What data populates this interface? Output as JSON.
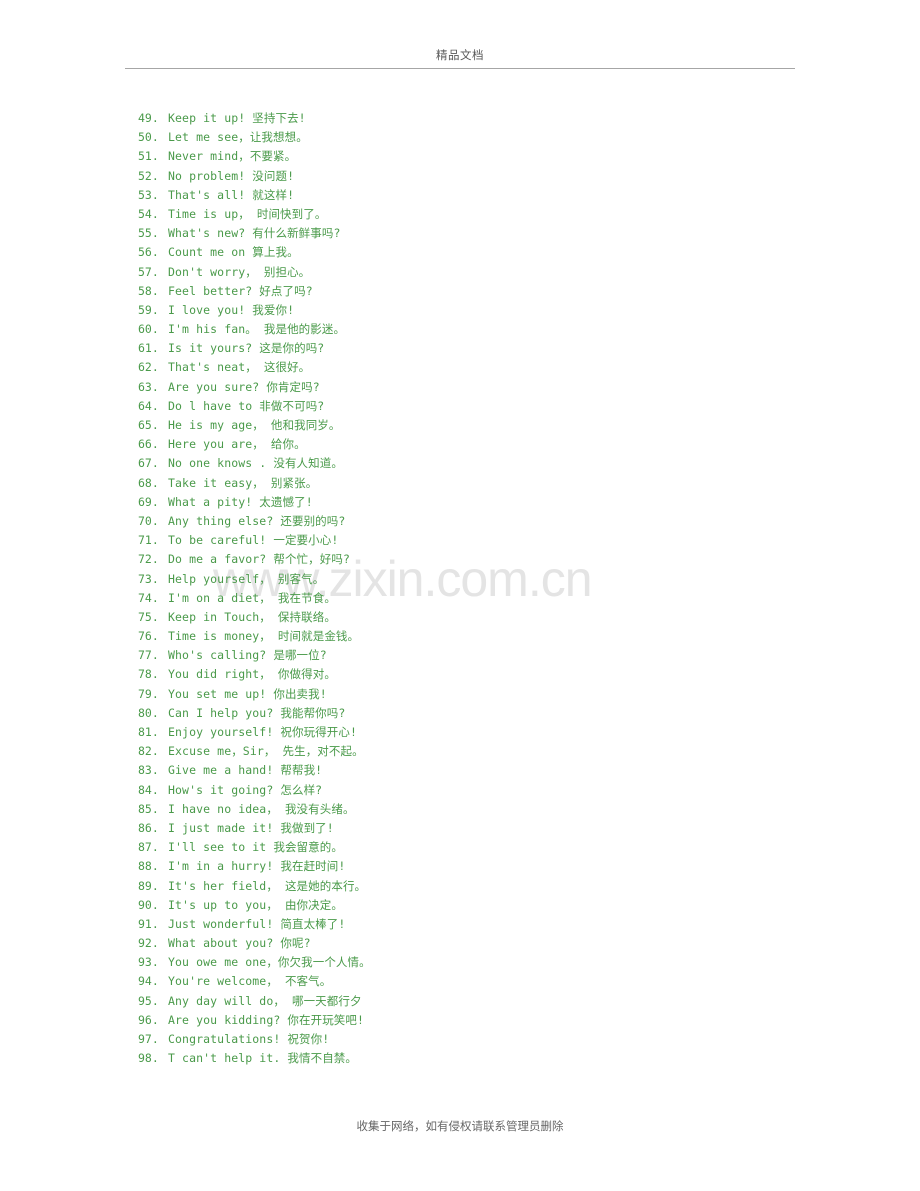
{
  "header": {
    "title": "精品文档"
  },
  "watermark": {
    "text": "www.zixin.com.cn",
    "color": "#e4e4e4"
  },
  "footer": {
    "text": "收集于网络，如有侵权请联系管理员删除"
  },
  "theme": {
    "text_color": "#4a9a4a",
    "header_color": "#595959",
    "rule_color": "#a6a6a6",
    "footer_color": "#666666",
    "page_background": "#ffffff"
  },
  "list": {
    "items": [
      {
        "num": "49.",
        "text": "Keep it up! 坚持下去!"
      },
      {
        "num": "50.",
        "text": "Let me see，让我想想。"
      },
      {
        "num": "51.",
        "text": "Never mind，不要紧。"
      },
      {
        "num": "52.",
        "text": "No problem! 没问题!"
      },
      {
        "num": "53.",
        "text": "That's all! 就这样!"
      },
      {
        "num": "54.",
        "text": "Time is up， 时间快到了。"
      },
      {
        "num": "55.",
        "text": "What's new? 有什么新鲜事吗?"
      },
      {
        "num": "56.",
        "text": "Count me on 算上我。"
      },
      {
        "num": "57.",
        "text": "Don't worry， 别担心。"
      },
      {
        "num": "58.",
        "text": "Feel better? 好点了吗?"
      },
      {
        "num": "59.",
        "text": "I love you! 我爱你!"
      },
      {
        "num": "60.",
        "text": "I'm his fan。 我是他的影迷。"
      },
      {
        "num": "61.",
        "text": "Is it yours? 这是你的吗?"
      },
      {
        "num": "62.",
        "text": "That's neat， 这很好。"
      },
      {
        "num": "63.",
        "text": "Are you sure? 你肯定吗?"
      },
      {
        "num": "64.",
        "text": "Do l have to 非做不可吗?"
      },
      {
        "num": "65.",
        "text": "He is my age， 他和我同岁。"
      },
      {
        "num": "66.",
        "text": "Here you are， 给你。"
      },
      {
        "num": "67.",
        "text": "No one knows . 没有人知道。"
      },
      {
        "num": "68.",
        "text": "Take it easy， 别紧张。"
      },
      {
        "num": "69.",
        "text": "What a pity! 太遗憾了!"
      },
      {
        "num": "70.",
        "text": "Any thing else? 还要别的吗?"
      },
      {
        "num": "71.",
        "text": "To be careful! 一定要小心!"
      },
      {
        "num": "72.",
        "text": "Do me a favor? 帮个忙，好吗?"
      },
      {
        "num": "73.",
        "text": "Help yourself， 别客气。"
      },
      {
        "num": "74.",
        "text": "I'm on a diet， 我在节食。"
      },
      {
        "num": "75.",
        "text": "Keep in Touch， 保持联络。"
      },
      {
        "num": "76.",
        "text": "Time is money， 时间就是金钱。"
      },
      {
        "num": "77.",
        "text": "Who's calling? 是哪一位?"
      },
      {
        "num": "78.",
        "text": "You did right， 你做得对。"
      },
      {
        "num": "79.",
        "text": "You set me up! 你出卖我!"
      },
      {
        "num": "80.",
        "text": "Can I help you? 我能帮你吗?"
      },
      {
        "num": "81.",
        "text": "Enjoy yourself! 祝你玩得开心!"
      },
      {
        "num": "82.",
        "text": "Excuse me，Sir， 先生，对不起。"
      },
      {
        "num": "83.",
        "text": "Give me a hand! 帮帮我!"
      },
      {
        "num": "84.",
        "text": "How's it going? 怎么样?"
      },
      {
        "num": "85.",
        "text": "I have no idea， 我没有头绪。"
      },
      {
        "num": "86.",
        "text": "I just made it! 我做到了!"
      },
      {
        "num": "87.",
        "text": "I'll see to it 我会留意的。"
      },
      {
        "num": "88.",
        "text": "I'm in a hurry! 我在赶时间!"
      },
      {
        "num": "89.",
        "text": "It's her field， 这是她的本行。"
      },
      {
        "num": "90.",
        "text": "It's up to you， 由你决定。"
      },
      {
        "num": "91.",
        "text": "Just wonderful! 简直太棒了!"
      },
      {
        "num": "92.",
        "text": "What about you? 你呢?"
      },
      {
        "num": "93.",
        "text": "You owe me one，你欠我一个人情。"
      },
      {
        "num": "94.",
        "text": "You're welcome， 不客气。"
      },
      {
        "num": "95.",
        "text": "Any day will do， 哪一天都行夕"
      },
      {
        "num": "96.",
        "text": "Are you kidding? 你在开玩笑吧!"
      },
      {
        "num": "97.",
        "text": "Congratulations! 祝贺你!"
      },
      {
        "num": "98.",
        "text": "T can't help it. 我情不自禁。"
      }
    ]
  }
}
